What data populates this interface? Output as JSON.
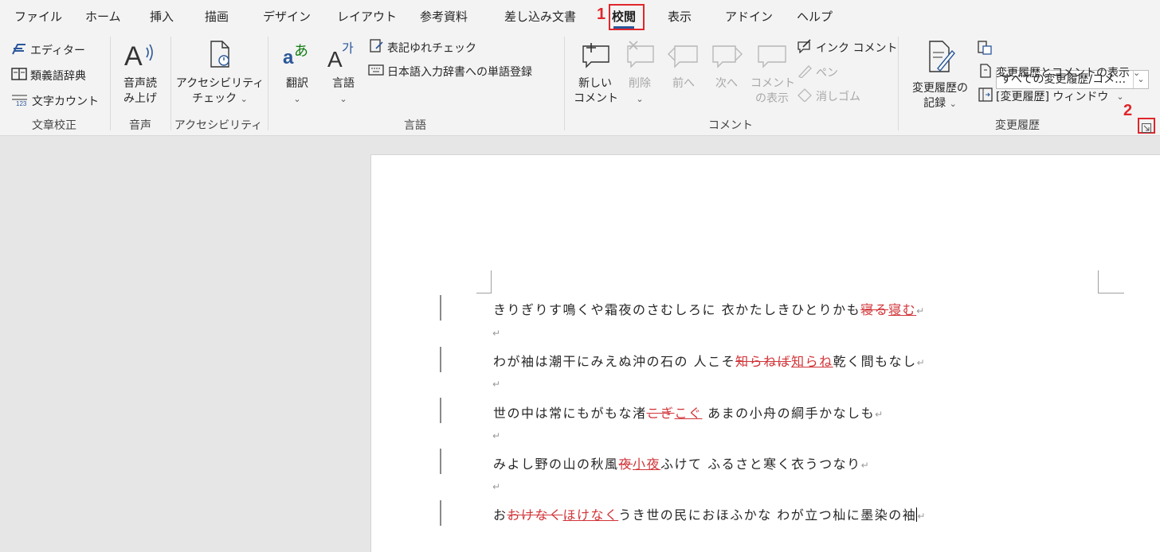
{
  "tabs": [
    "ファイル",
    "ホーム",
    "挿入",
    "描画",
    "デザイン",
    "レイアウト",
    "参考資料",
    "差し込み文書",
    "校閲",
    "表示",
    "アドイン",
    "ヘルプ"
  ],
  "active_tab": "校閲",
  "markers": {
    "one": "1",
    "two": "2"
  },
  "ribbon": {
    "proofing": {
      "editor": "エディター",
      "thesaurus": "類義語辞典",
      "word_count": "文字カウント",
      "group": "文章校正"
    },
    "speech": {
      "read_aloud_1": "音声読",
      "read_aloud_2": "み上げ",
      "group": "音声"
    },
    "accessibility": {
      "check_1": "アクセシビリティ",
      "check_2": "チェック",
      "group": "アクセシビリティ"
    },
    "language": {
      "translate": "翻訳",
      "language": "言語",
      "notation": "表記ゆれチェック",
      "ime_dict": "日本語入力辞書への単語登録",
      "group": "言語"
    },
    "comments": {
      "new_1": "新しい",
      "new_2": "コメント",
      "delete": "削除",
      "prev": "前へ",
      "next": "次へ",
      "show_1": "コメント",
      "show_2": "の表示",
      "ink": "インク コメント",
      "pen": "ペン",
      "eraser": "消しゴム",
      "group": "コメント"
    },
    "tracking": {
      "track_1": "変更履歴の",
      "track_2": "記録",
      "display_value": "すべての変更履歴/コメ…",
      "show_markup": "変更履歴とコメントの表示",
      "pane": "[変更履歴] ウィンドウ",
      "group": "変更履歴"
    }
  },
  "document": {
    "lines": [
      {
        "before": "きりぎりす鳴くや霜夜のさむしろに 衣かたしきひとりかも",
        "deleted": "寝る",
        "inserted": "寝む",
        "after": ""
      },
      {
        "before": "わが袖は潮干にみえぬ沖の石の 人こそ",
        "deleted": "知らねば",
        "inserted": "知らね",
        "after": "乾く間もなし"
      },
      {
        "before": "世の中は常にもがもな渚",
        "deleted": "こぎ",
        "inserted": "こぐ",
        "after": " あまの小舟の綱手かなしも"
      },
      {
        "before": "みよし野の山の秋風",
        "deleted": "夜",
        "inserted": "小夜",
        "after": "ふけて ふるさと寒く衣うつなり"
      },
      {
        "before": "お",
        "deleted": "おけなく",
        "inserted": "ほけなく",
        "after": "うき世の民におほふかな わが立つ杣に墨染の袖"
      }
    ],
    "para_mark": "↵"
  }
}
